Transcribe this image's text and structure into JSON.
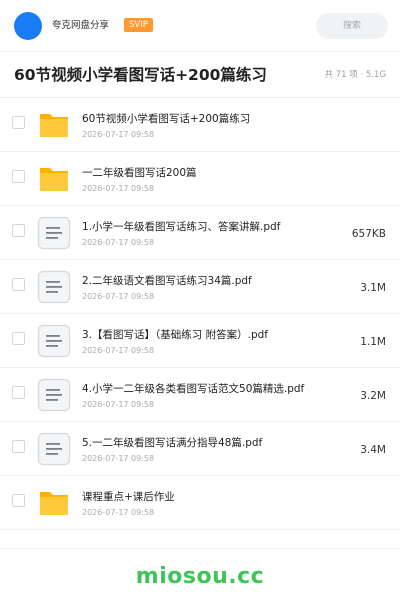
{
  "header": {
    "owner": "夸克网盘分享",
    "badge": "SVIP",
    "search_placeholder": "搜索"
  },
  "folder": {
    "title": "60节视频小学看图写话+200篇练习",
    "summary": "共 71 项 · 5.1G"
  },
  "items": [
    {
      "type": "folder",
      "name": "60节视频小学看图写话+200篇练习",
      "date": "2026-07-17 09:58",
      "size": ""
    },
    {
      "type": "folder",
      "name": "一二年级看图写话200篇",
      "date": "2026-07-17 09:58",
      "size": ""
    },
    {
      "type": "file",
      "name": "1.小学一年级看图写话练习、答案讲解.pdf",
      "date": "2026-07-17 09:58",
      "size": "657KB"
    },
    {
      "type": "file",
      "name": "2.二年级语文看图写话练习34篇.pdf",
      "date": "2026-07-17 09:58",
      "size": "3.1M"
    },
    {
      "type": "file",
      "name": "3.【看图写话】（基础练习 附答案）.pdf",
      "date": "2026-07-17 09:58",
      "size": "1.1M"
    },
    {
      "type": "file",
      "name": "4.小学一二年级各类看图写话范文50篇精选.pdf",
      "date": "2026-07-17 09:58",
      "size": "3.2M"
    },
    {
      "type": "file",
      "name": "5.一二年级看图写话满分指导48篇.pdf",
      "date": "2026-07-17 09:58",
      "size": "3.4M"
    },
    {
      "type": "folder",
      "name": "课程重点+课后作业",
      "date": "2026-07-17 09:58",
      "size": ""
    }
  ],
  "watermark": "miosou.cc",
  "colors": {
    "accent": "#1a7cf5",
    "badge": "#ff9a2e",
    "folder": "#ffc400",
    "watermark": "#3fc35a"
  }
}
